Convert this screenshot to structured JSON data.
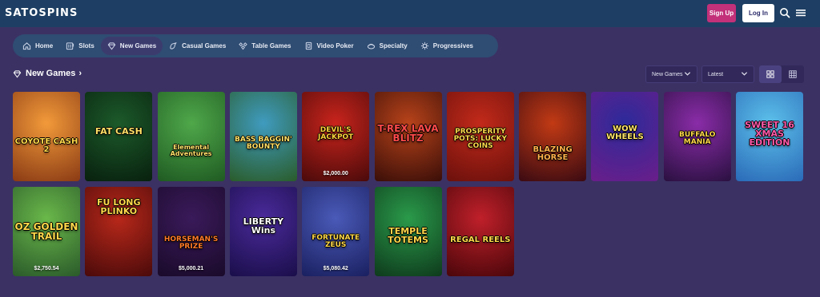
{
  "header": {
    "logo": "SATOSPINS",
    "signup_label": "Sign Up",
    "login_label": "Log In"
  },
  "nav": {
    "categories": [
      {
        "label": "Home",
        "icon": "home-icon",
        "active": false
      },
      {
        "label": "Slots",
        "icon": "slots-icon",
        "active": false
      },
      {
        "label": "New Games",
        "icon": "diamond-icon",
        "active": true
      },
      {
        "label": "Casual Games",
        "icon": "casual-icon",
        "active": false
      },
      {
        "label": "Table Games",
        "icon": "table-icon",
        "active": false
      },
      {
        "label": "Video Poker",
        "icon": "poker-icon",
        "active": false
      },
      {
        "label": "Specialty",
        "icon": "specialty-icon",
        "active": false
      },
      {
        "label": "Progressives",
        "icon": "progressive-icon",
        "active": false
      }
    ]
  },
  "section": {
    "title": "New Games",
    "filter_value": "New Games",
    "sort_value": "Latest"
  },
  "games": [
    {
      "title": "COYOTE CASH 2",
      "jackpot": "",
      "colors": [
        "#f29a3a",
        "#8a3a14"
      ]
    },
    {
      "title": "FAT CASH",
      "jackpot": "",
      "colors": [
        "#1c5a2a",
        "#08200e"
      ]
    },
    {
      "title": "Elemental Adventures",
      "jackpot": "",
      "colors": [
        "#4fa84a",
        "#1f5a22"
      ]
    },
    {
      "title": "BASS BAGGIN' BOUNTY",
      "jackpot": "",
      "colors": [
        "#3f9bbf",
        "#2a5c2a"
      ]
    },
    {
      "title": "DEVIL'S JACKPOT",
      "jackpot": "$2,000.00",
      "colors": [
        "#c9241c",
        "#4a0a0a"
      ]
    },
    {
      "title": "T-REX LAVA BLITZ",
      "jackpot": "",
      "colors": [
        "#b8431a",
        "#3a0e08"
      ]
    },
    {
      "title": "PROSPERITY POTS: LUCKY COINS",
      "jackpot": "",
      "colors": [
        "#c22a1a",
        "#6b100c"
      ]
    },
    {
      "title": "BLAZING HORSE",
      "jackpot": "",
      "colors": [
        "#c23a14",
        "#3a0a12"
      ]
    },
    {
      "title": "WOW WHEELS",
      "jackpot": "",
      "colors": [
        "#2d2a9a",
        "#6a1e8a"
      ]
    },
    {
      "title": "BUFFALO MANIA",
      "jackpot": "",
      "colors": [
        "#8a2ca8",
        "#2a1040"
      ]
    },
    {
      "title": "SWEET 16 XMAS EDITION",
      "jackpot": "",
      "colors": [
        "#5cc0ea",
        "#2a6ab8"
      ]
    },
    {
      "title": "OZ GOLDEN TRAIL",
      "jackpot": "$2,750.54",
      "colors": [
        "#6ab84a",
        "#2a5a2a"
      ]
    },
    {
      "title": "FU LONG PLINKO",
      "jackpot": "",
      "colors": [
        "#b8281a",
        "#4a0a0a"
      ]
    },
    {
      "title": "HORSEMAN'S PRIZE",
      "jackpot": "$5,000.21",
      "colors": [
        "#3a1a5a",
        "#1a0a2a"
      ]
    },
    {
      "title": "LIBERTY Wins",
      "jackpot": "",
      "colors": [
        "#4a2a9a",
        "#1a0e4a"
      ]
    },
    {
      "title": "FORTUNATE ZEUS",
      "jackpot": "$5,080.42",
      "colors": [
        "#4a5ab8",
        "#1a2060"
      ]
    },
    {
      "title": "TEMPLE TOTEMS",
      "jackpot": "",
      "colors": [
        "#2a9a4a",
        "#0e3a1c"
      ]
    },
    {
      "title": "REGAL REELS",
      "jackpot": "",
      "colors": [
        "#c0202a",
        "#4a060a"
      ]
    }
  ]
}
